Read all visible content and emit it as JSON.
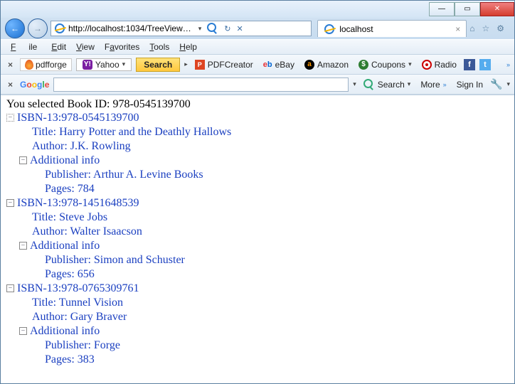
{
  "titlebar": {
    "minimize": "—",
    "maximize": "▭",
    "close": "✕"
  },
  "nav": {
    "back": "←",
    "forward": "→",
    "url": "http://localhost:1034/TreeView…",
    "dropdown": "▾",
    "refresh": "↻",
    "stop": "✕",
    "search_hint": "🔍"
  },
  "tab": {
    "title": "localhost",
    "close": "×"
  },
  "chrome": {
    "home": "⌂",
    "star": "☆",
    "gear": "⚙"
  },
  "menu": {
    "file": "File",
    "edit": "Edit",
    "view": "View",
    "favorites": "Favorites",
    "tools": "Tools",
    "help": "Help"
  },
  "tb1": {
    "pdfforge": "pdfforge",
    "yahoo": "Yahoo",
    "search": "Search",
    "pdfcreator": "PDFCreator",
    "ebay": "eBay",
    "amazon": "Amazon",
    "coupons": "Coupons",
    "radio": "Radio",
    "more": "»"
  },
  "tb2": {
    "google": "Google",
    "search": "Search",
    "more": "More",
    "signin": "Sign In"
  },
  "page": {
    "selected": "You selected Book ID: 978-0545139700",
    "books": [
      {
        "isbn": "ISBN-13:978-0545139700",
        "title": "Title: Harry Potter and the Deathly Hallows",
        "author": "Author: J.K. Rowling",
        "additional": "Additional info",
        "publisher": "Publisher: Arthur A. Levine Books",
        "pages": "Pages: 784"
      },
      {
        "isbn": "ISBN-13:978-1451648539",
        "title": "Title: Steve Jobs",
        "author": "Author: Walter Isaacson",
        "additional": "Additional info",
        "publisher": "Publisher: Simon and Schuster",
        "pages": "Pages: 656"
      },
      {
        "isbn": "ISBN-13:978-0765309761",
        "title": "Title: Tunnel Vision",
        "author": "Author: Gary Braver",
        "additional": "Additional info",
        "publisher": "Publisher: Forge",
        "pages": "Pages: 383"
      }
    ]
  }
}
